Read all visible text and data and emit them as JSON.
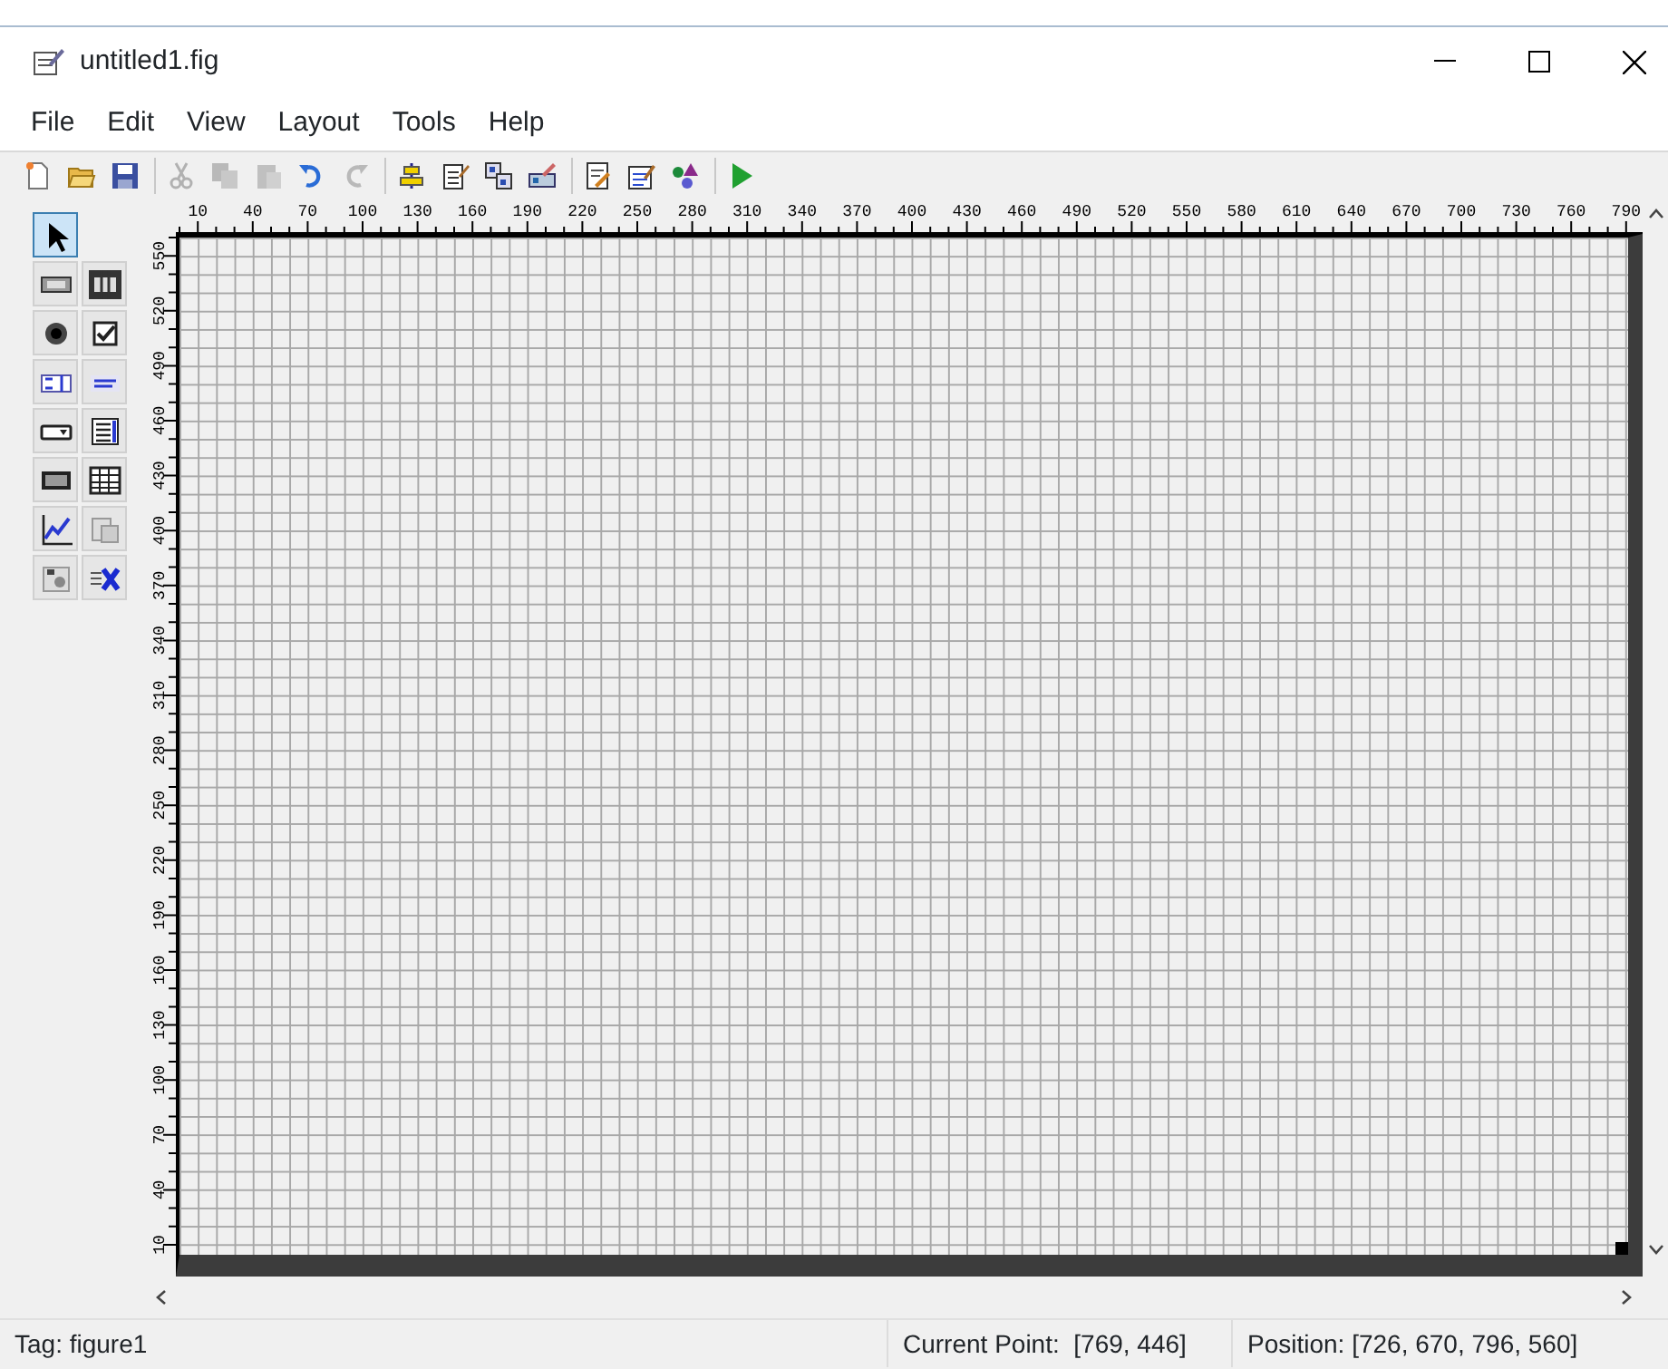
{
  "window": {
    "title": "untitled1.fig"
  },
  "menu": [
    "File",
    "Edit",
    "View",
    "Layout",
    "Tools",
    "Help"
  ],
  "toolbar": [
    [
      {
        "kind": "new",
        "disabled": false
      },
      {
        "kind": "open",
        "disabled": false
      },
      {
        "kind": "save",
        "disabled": false
      }
    ],
    [
      {
        "kind": "cut",
        "disabled": true
      },
      {
        "kind": "copy",
        "disabled": true
      },
      {
        "kind": "paste",
        "disabled": true
      },
      {
        "kind": "undo",
        "disabled": false
      },
      {
        "kind": "redo",
        "disabled": true
      }
    ],
    [
      {
        "kind": "align",
        "disabled": false
      },
      {
        "kind": "menu-editor",
        "disabled": false
      },
      {
        "kind": "tab-order",
        "disabled": false
      },
      {
        "kind": "toolbar-editor",
        "disabled": false
      }
    ],
    [
      {
        "kind": "editor",
        "disabled": false
      },
      {
        "kind": "inspector",
        "disabled": false
      },
      {
        "kind": "browser",
        "disabled": false
      }
    ],
    [
      {
        "kind": "run",
        "disabled": false
      }
    ]
  ],
  "palette": [
    {
      "kind": "pointer",
      "selected": true
    },
    {
      "kind": "push",
      "selected": false
    },
    {
      "kind": "slider",
      "selected": false
    },
    {
      "kind": "radio",
      "selected": false
    },
    {
      "kind": "checkbox",
      "selected": false
    },
    {
      "kind": "edit",
      "selected": false
    },
    {
      "kind": "text",
      "selected": false
    },
    {
      "kind": "popup",
      "selected": false
    },
    {
      "kind": "listbox",
      "selected": false
    },
    {
      "kind": "toggle",
      "selected": false
    },
    {
      "kind": "table",
      "selected": false
    },
    {
      "kind": "axes",
      "selected": false
    },
    {
      "kind": "panel",
      "selected": false
    },
    {
      "kind": "group",
      "selected": false
    },
    {
      "kind": "activex",
      "selected": false
    }
  ],
  "top_ruler": [
    "10",
    "40",
    "70",
    "100",
    "130",
    "160",
    "190",
    "220",
    "250",
    "280",
    "310",
    "340",
    "370",
    "400",
    "430",
    "460",
    "490",
    "520",
    "550",
    "580",
    "610",
    "640",
    "670",
    "700",
    "730",
    "760",
    "790"
  ],
  "left_ruler": [
    "550",
    "520",
    "490",
    "460",
    "430",
    "400",
    "370",
    "340",
    "310",
    "280",
    "250",
    "220",
    "190",
    "160",
    "130",
    "100",
    "70",
    "40",
    "10"
  ],
  "status_bar": {
    "tag": "Tag: figure1",
    "current_point": "Current Point:  [769, 446]",
    "position": "Position: [726, 670, 796, 560]"
  }
}
